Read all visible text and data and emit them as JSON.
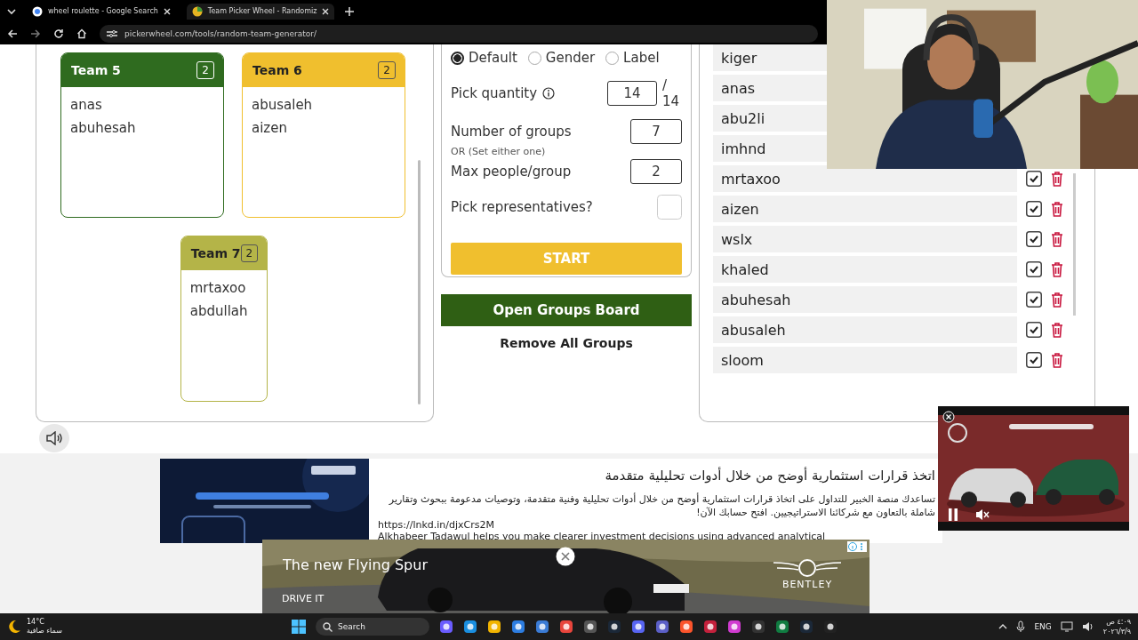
{
  "browser": {
    "tabs": [
      {
        "title": "wheel roulette - Google Search",
        "selected": false
      },
      {
        "title": "Team Picker Wheel - Randomiz",
        "selected": true
      }
    ],
    "address": "pickerwheel.com/tools/random-team-generator/"
  },
  "teams": [
    {
      "name": "Team 5",
      "count": "2",
      "color": "#2f6b1f",
      "members": [
        "anas",
        "abuhesah"
      ]
    },
    {
      "name": "Team 6",
      "count": "2",
      "color": "#f0bf2e",
      "members": [
        "abusaleh",
        "aizen"
      ]
    },
    {
      "name": "Team 7",
      "count": "2",
      "color": "#b4b448",
      "members": [
        "mrtaxoo",
        "abdullah"
      ]
    }
  ],
  "settings": {
    "group_by": [
      {
        "label": "Default",
        "selected": true
      },
      {
        "label": "Gender",
        "selected": false
      },
      {
        "label": "Label",
        "selected": false
      }
    ],
    "pick_quantity": {
      "label": "Pick quantity",
      "value": "14",
      "total": "/ 14"
    },
    "groups": {
      "label": "Number of groups",
      "value": "7"
    },
    "or_note": "OR (Set either one)",
    "max_per_group": {
      "label": "Max people/group",
      "value": "2"
    },
    "representatives": {
      "label": "Pick representatives?",
      "checked": false
    },
    "start": "START"
  },
  "open_board": "Open Groups Board",
  "remove_all": "Remove All Groups",
  "entries": [
    {
      "name": "kiger"
    },
    {
      "name": "anas"
    },
    {
      "name": "abu2li"
    },
    {
      "name": "imhnd"
    },
    {
      "name": "mrtaxoo",
      "checked": true
    },
    {
      "name": "aizen",
      "checked": true
    },
    {
      "name": "wslx",
      "checked": true
    },
    {
      "name": "khaled",
      "checked": true
    },
    {
      "name": "abuhesah",
      "checked": true
    },
    {
      "name": "abusaleh",
      "checked": true
    },
    {
      "name": "sloom",
      "checked": true
    }
  ],
  "ad_banner": {
    "title": "اتخذ قرارات استثمارية أوضح من خلال أدوات تحليلية متقدمة",
    "body": "تساعدك منصة الخبير للتداول على اتخاذ قرارات استثمارية أوضح من خلال أدوات تحليلية وفنية متقدمة، وتوصيات مدعومة ببحوث وتقارير شاملة بالتعاون مع شركائنا الاستراتيجيين. افتح حسابك الآن!",
    "link": "https://lnkd.in/djxCrs2M",
    "body_en": "Alkhabeer Tadawul helps you make clearer investment decisions using advanced analytical"
  },
  "video_ad": {
    "headline": "The new Flying Spur",
    "cta": "DRIVE IT",
    "brand": "BENTLEY"
  },
  "taskbar": {
    "temperature": "14°C",
    "weather": "سماء صافية",
    "search": "Search",
    "language": "ENG",
    "time": "٤:٠٩ ص",
    "date": "٢٠٢٦/٣/٩"
  }
}
